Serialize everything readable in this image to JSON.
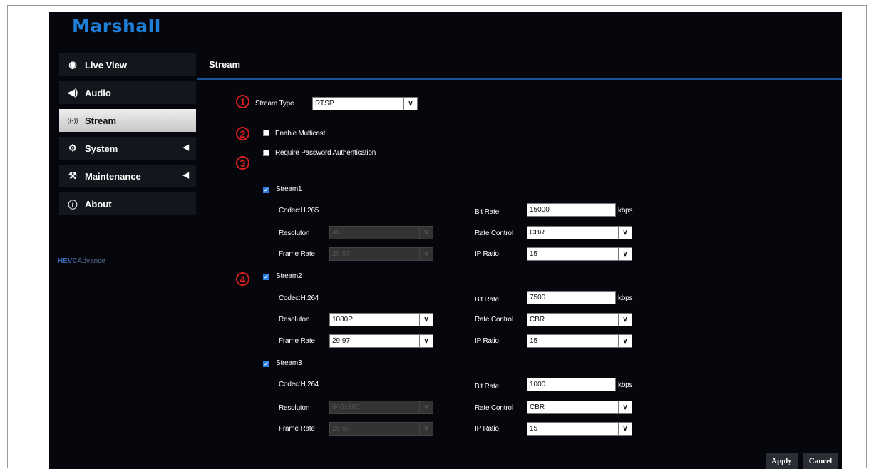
{
  "app": {
    "logo": "Marshall"
  },
  "sidebar": {
    "items": [
      {
        "label": "Live View",
        "icon": "eye-icon"
      },
      {
        "label": "Audio",
        "icon": "speaker-icon"
      },
      {
        "label": "Stream",
        "icon": "broadcast-icon",
        "active": true
      },
      {
        "label": "System",
        "icon": "gear-icon"
      },
      {
        "label": "Maintenance",
        "icon": "wrench-icon"
      },
      {
        "label": "About",
        "icon": "info-icon"
      }
    ],
    "hevc_logo": "HEVC",
    "hevc_logo_suffix": "Advance"
  },
  "header": {
    "title": "Stream"
  },
  "badges": [
    "1",
    "2",
    "3",
    "4"
  ],
  "form": {
    "stream_type_label": "Stream Type",
    "stream_type_value": "RTSP",
    "enable_multicast_label": "Enable Multicast",
    "require_password_label": "Require Password Authentication"
  },
  "streams": [
    {
      "name": "Stream1",
      "codec": "Codec:H.265",
      "resolution_label": "Resoluton",
      "resolution_value": "4K",
      "framerate_label": "Frame Rate",
      "framerate_value": "29.97",
      "bitrate_label": "Bit Rate",
      "bitrate_value": "15000",
      "unit": "kbps",
      "rate_control_label": "Rate Control",
      "rate_control_value": "CBR",
      "ip_ratio_label": "IP Ratio",
      "ip_ratio_value": "15"
    },
    {
      "name": "Stream2",
      "codec": "Codec:H.264",
      "resolution_label": "Resoluton",
      "resolution_value": "1080P",
      "framerate_label": "Frame Rate",
      "framerate_value": "29.97",
      "bitrate_label": "Bit Rate",
      "bitrate_value": "7500",
      "unit": "kbps",
      "rate_control_label": "Rate Control",
      "rate_control_value": "CBR",
      "ip_ratio_label": "IP Ratio",
      "ip_ratio_value": "15"
    },
    {
      "name": "Stream3",
      "codec": "Codec:H.264",
      "resolution_label": "Resoluton",
      "resolution_value": "640x360",
      "framerate_label": "Frame Rate",
      "framerate_value": "29.97",
      "bitrate_label": "Bit Rate",
      "bitrate_value": "1000",
      "unit": "kbps",
      "rate_control_label": "Rate Control",
      "rate_control_value": "CBR",
      "ip_ratio_label": "IP Ratio",
      "ip_ratio_value": "15"
    }
  ],
  "buttons": {
    "apply": "Apply",
    "cancel": "Cancel"
  }
}
